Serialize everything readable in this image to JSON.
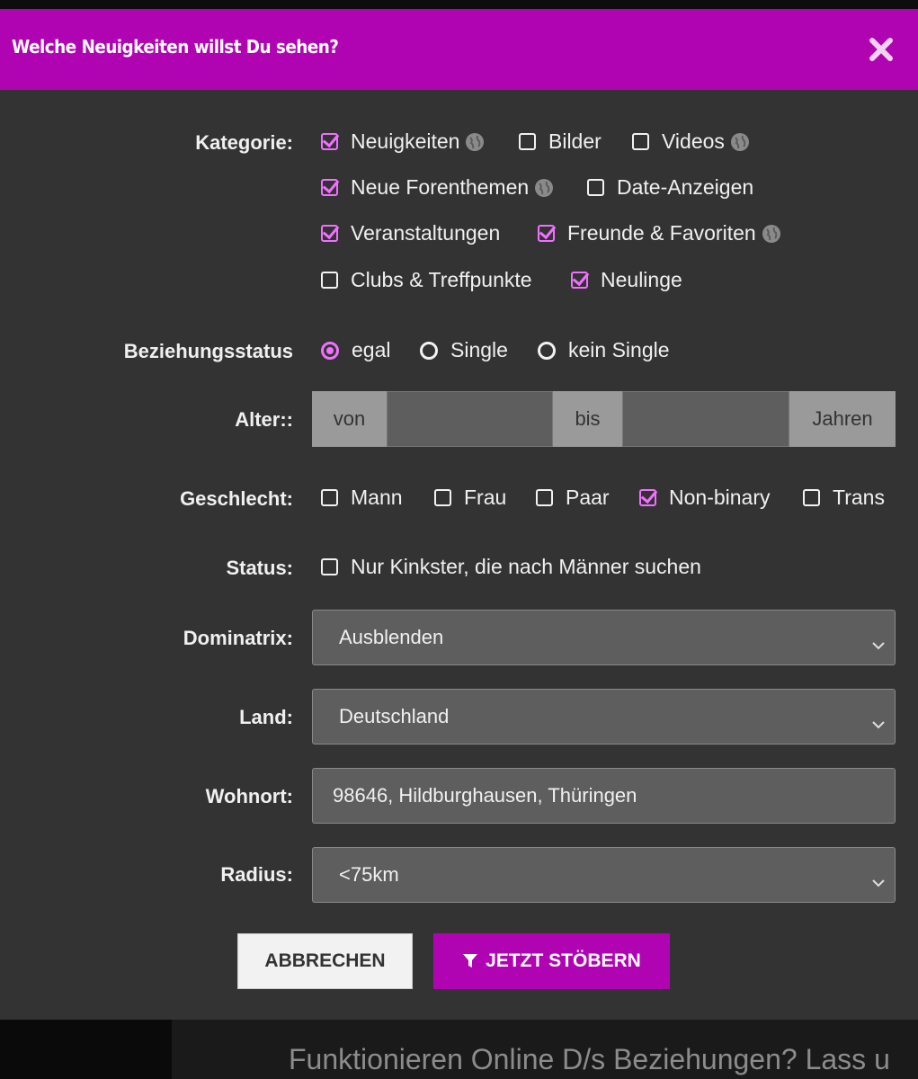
{
  "dialog": {
    "title": "Welche Neuigkeiten willst Du sehen?",
    "close_icon": "close-icon"
  },
  "kategorie": {
    "label": "Kategorie:",
    "items": [
      {
        "label": "Neuigkeiten",
        "checked": true,
        "globe": true
      },
      {
        "label": "Bilder",
        "checked": false,
        "globe": false
      },
      {
        "label": "Videos",
        "checked": false,
        "globe": true
      },
      {
        "label": "Neue Forenthemen",
        "checked": true,
        "globe": true
      },
      {
        "label": "Date-Anzeigen",
        "checked": false,
        "globe": false
      },
      {
        "label": "Veranstaltungen",
        "checked": true,
        "globe": false
      },
      {
        "label": "Freunde & Favoriten",
        "checked": true,
        "globe": true
      },
      {
        "label": "Clubs & Treffpunkte",
        "checked": false,
        "globe": false
      },
      {
        "label": "Neulinge",
        "checked": true,
        "globe": false
      }
    ]
  },
  "beziehungsstatus": {
    "label": "Beziehungsstatus",
    "options": [
      {
        "label": "egal",
        "selected": true
      },
      {
        "label": "Single",
        "selected": false
      },
      {
        "label": "kein Single",
        "selected": false
      }
    ]
  },
  "alter": {
    "label": "Alter::",
    "von": "von",
    "bis": "bis",
    "unit": "Jahren",
    "from_value": "",
    "to_value": ""
  },
  "geschlecht": {
    "label": "Geschlecht:",
    "items": [
      {
        "label": "Mann",
        "checked": false
      },
      {
        "label": "Frau",
        "checked": false
      },
      {
        "label": "Paar",
        "checked": false
      },
      {
        "label": "Non-binary",
        "checked": true
      },
      {
        "label": "Trans",
        "checked": false
      }
    ]
  },
  "status": {
    "label": "Status:",
    "option": {
      "label": "Nur Kinkster, die nach Männer suchen",
      "checked": false
    }
  },
  "dominatrix": {
    "label": "Dominatrix:",
    "value": "Ausblenden"
  },
  "land": {
    "label": "Land:",
    "value": "Deutschland"
  },
  "wohnort": {
    "label": "Wohnort:",
    "value": "98646, Hildburghausen, Thüringen"
  },
  "radius": {
    "label": "Radius:",
    "value": "<75km"
  },
  "buttons": {
    "cancel": "ABBRECHEN",
    "submit": "JETZT STÖBERN"
  },
  "footer": {
    "headline": "Funktionieren Online D/s Beziehungen? Lass u"
  },
  "colors": {
    "accent": "#b004b2",
    "check": "#f070ff",
    "panel": "#333333"
  }
}
